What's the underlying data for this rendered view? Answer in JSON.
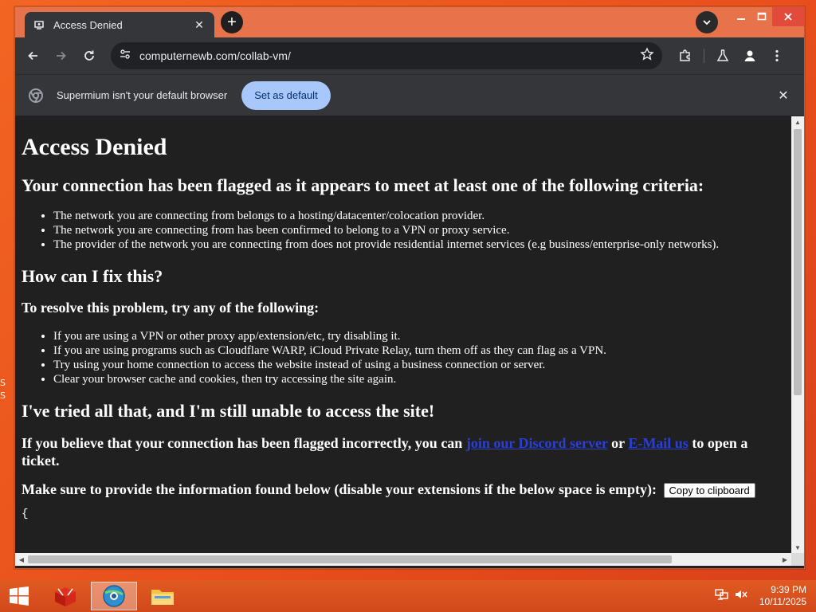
{
  "browser": {
    "tab_title": "Access Denied",
    "url": "computernewb.com/collab-vm/",
    "infobar_message": "Supermium isn't your default browser",
    "infobar_button": "Set as default"
  },
  "page": {
    "h1": "Access Denied",
    "criteria_heading": "Your connection has been flagged as it appears to meet at least one of the following criteria:",
    "criteria": [
      "The network you are connecting from belongs to a hosting/datacenter/colocation provider.",
      "The network you are connecting from has been confirmed to belong to a VPN or proxy service.",
      "The provider of the network you are connecting from does not provide residential internet services (e.g business/enterprise-only networks)."
    ],
    "fix_heading": "How can I fix this?",
    "resolve_heading": "To resolve this problem, try any of the following:",
    "fixes": [
      "If you are using a VPN or other proxy app/extension/etc, try disabling it.",
      "If you are using programs such as Cloudflare WARP, iCloud Private Relay, turn them off as they can flag as a VPN.",
      "Try using your home connection to access the website instead of using a business connection or server.",
      "Clear your browser cache and cookies, then try accessing the site again."
    ],
    "still_heading": "I've tried all that, and I'm still unable to access the site!",
    "believe_pre": "If you believe that your connection has been flagged incorrectly, you can",
    "discord_link": "join our Discord server",
    "or_text": "or",
    "email_link": "E-Mail us",
    "believe_post": "to open a ticket.",
    "provide_text": "Make sure to provide the information found below (disable your extensions if the below space is empty):",
    "copy_button": "Copy to clipboard",
    "json_open": "{"
  },
  "taskbar": {
    "time": "9:39 PM",
    "date": "10/11/2025"
  },
  "desktop": {
    "edge_chars": [
      "S",
      "S"
    ]
  },
  "colors": {
    "desktop": "#f26522",
    "page_bg": "#202020",
    "link": "#2a3fd6",
    "set_default_bg": "#a8c7fa"
  }
}
